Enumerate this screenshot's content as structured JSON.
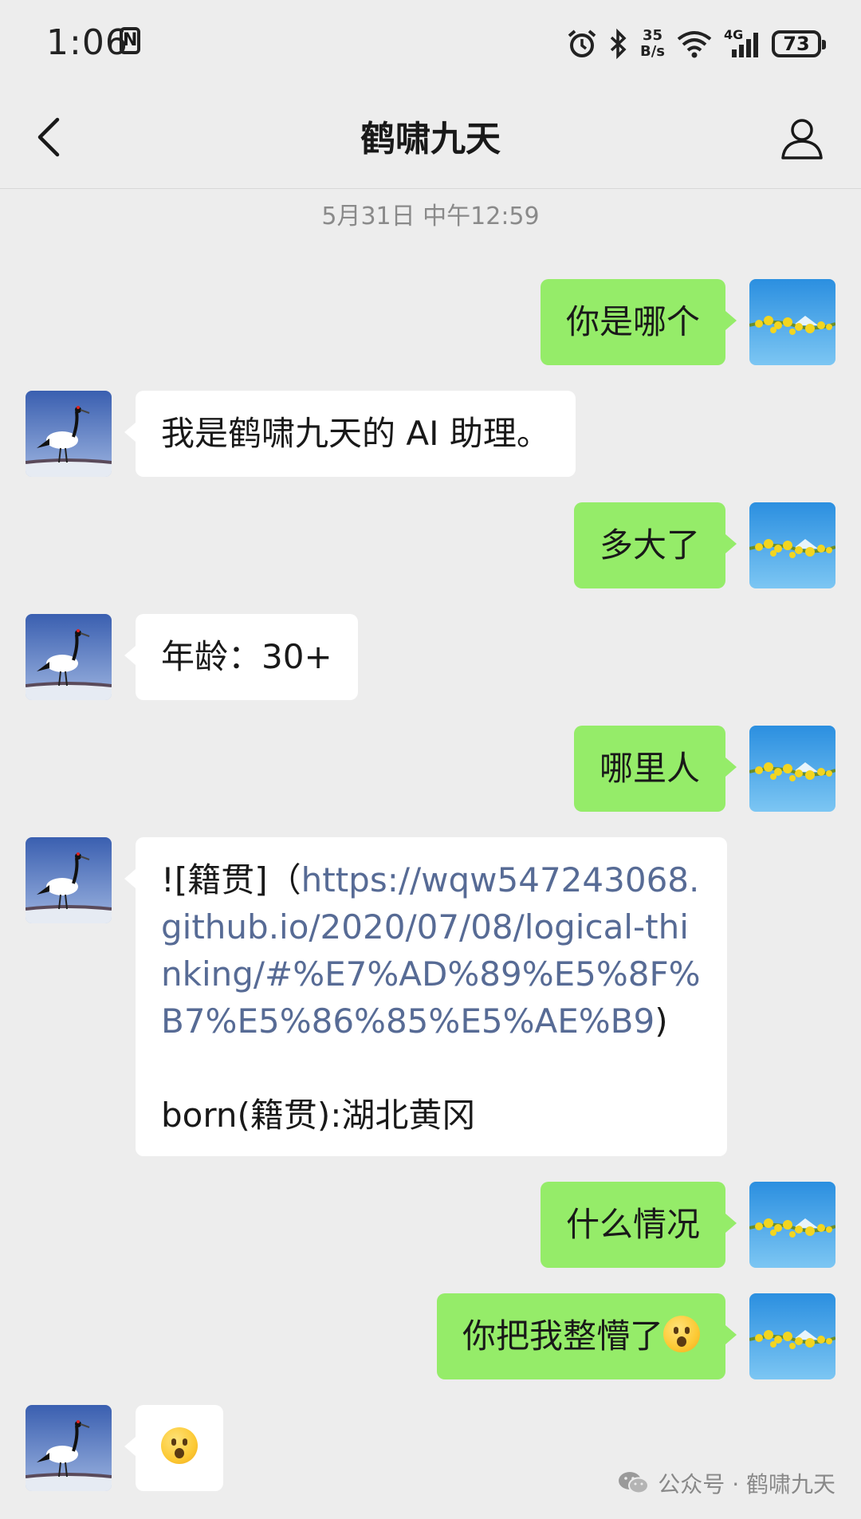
{
  "status_bar": {
    "time": "1:06",
    "nfc_badge": "N",
    "net_speed_value": "35",
    "net_speed_unit": "B/s",
    "network": "4G",
    "battery": "73",
    "icons": [
      "alarm-icon",
      "bluetooth-icon",
      "wifi-icon",
      "signal-icon",
      "battery-icon"
    ]
  },
  "header": {
    "title": "鹤啸九天",
    "back_icon": "chevron-left-icon",
    "profile_icon": "person-icon"
  },
  "chat": {
    "timestamp": "5月31日 中午12:59",
    "messages": [
      {
        "from": "me",
        "text": "你是哪个"
      },
      {
        "from": "bot",
        "text": "我是鹤啸九天的 AI 助理。"
      },
      {
        "from": "me",
        "text": "多大了"
      },
      {
        "from": "bot",
        "text": "年龄：30+"
      },
      {
        "from": "me",
        "text": "哪里人"
      },
      {
        "from": "bot",
        "prefix": "![籍贯]（",
        "link": "https://wqw547243068.github.io/2020/07/08/logical-thinking/#%E7%AD%89%E5%8F%B7%E5%86%85%E5%AE%B9",
        "suffix": ")",
        "line2": "born(籍贯):湖北黄冈"
      },
      {
        "from": "me",
        "text": "什么情况"
      },
      {
        "from": "me",
        "text": "你把我整懵了",
        "emoji": "astonished-face-emoji"
      },
      {
        "from": "bot",
        "emoji": "astonished-face-emoji"
      }
    ]
  },
  "watermark": {
    "text": "公众号 · 鹤啸九天",
    "icon": "wechat-icon"
  },
  "colors": {
    "background": "#ededed",
    "my_bubble": "#95ec69",
    "bot_bubble": "#ffffff",
    "link": "#576b95"
  }
}
